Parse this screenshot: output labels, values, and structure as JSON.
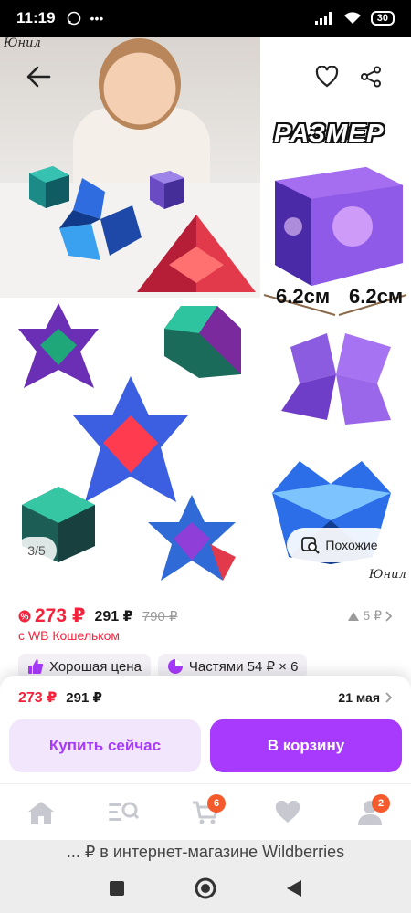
{
  "status_bar": {
    "time": "11:19",
    "battery": "30"
  },
  "gallery": {
    "watermark": "Юнил",
    "size_title": "РАЗМЕР",
    "size_width": "6.2см",
    "size_depth": "6.2см",
    "counter": "3/5",
    "similar_label": "Похожие"
  },
  "price": {
    "main": "273 ₽",
    "secondary": "291 ₽",
    "old": "790 ₽",
    "rating": "5 ₽",
    "wallet_note": "с WB Кошельком"
  },
  "badges": [
    {
      "label": "Хорошая цена"
    },
    {
      "label": "Частями 54 ₽ × 6"
    }
  ],
  "buy_sheet": {
    "price_main": "273 ₽",
    "price_secondary": "291 ₽",
    "delivery": "21 мая",
    "buy_now": "Купить сейчас",
    "add_to_cart": "В корзину"
  },
  "bottom_nav": {
    "cart_badge": "6",
    "profile_badge": "2"
  },
  "browser": {
    "title": "... ₽ в интернет-магазине Wildberries"
  },
  "colors": {
    "accent": "#a73afd",
    "price_red": "#f5223b"
  }
}
